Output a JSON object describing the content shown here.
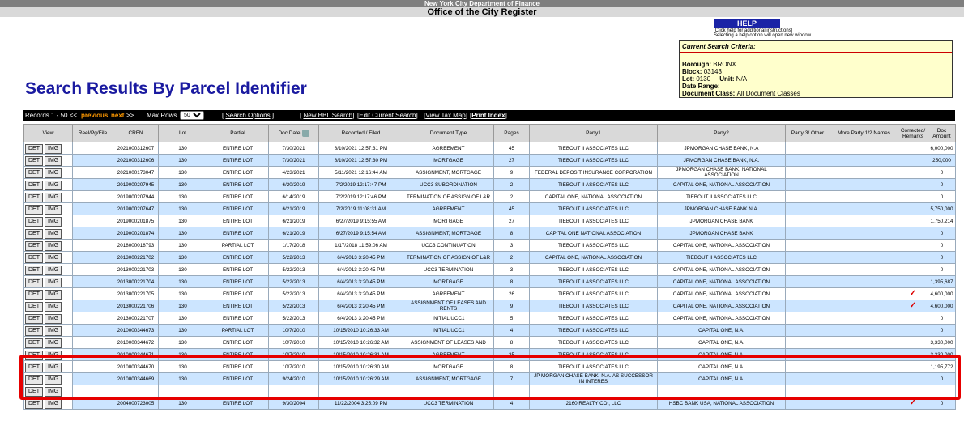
{
  "header": {
    "department": "New York City Department of Finance",
    "office": "Office of the City Register",
    "help_label": "HELP",
    "help_note_1": "[Click help for additional instructions]",
    "help_note_2": "Selecting a help option will open new window"
  },
  "criteria": {
    "title": "Current Search Criteria:",
    "borough_label": "Borough:",
    "borough": "BRONX",
    "block_label": "Block:",
    "block": "03143",
    "lot_label": "Lot:",
    "lot": "0130",
    "unit_label": "Unit:",
    "unit": "N/A",
    "date_label": "Date Range:",
    "class_label": "Document Class:",
    "class": "All Document Classes"
  },
  "page_title": "Search Results By Parcel Identifier",
  "toolbar": {
    "records": "Records 1 - 50 <<",
    "previous": "previous",
    "next": "next",
    "next_arrows": ">>",
    "max_rows_label": "Max Rows",
    "max_rows_value": "50",
    "search_options": "Search Options",
    "new_bbl": "New BBL Search",
    "edit_current": "Edit Current Search",
    "view_tax_map": "View Tax Map",
    "print_index": "Print Index"
  },
  "columns": [
    "View",
    "Reel/Pg/File",
    "CRFN",
    "Lot",
    "Partial",
    "Doc Date",
    "Recorded / Filed",
    "Document Type",
    "Pages",
    "Party1",
    "Party2",
    "Party 3/ Other",
    "More Party 1/2 Names",
    "Corrected/ Remarks",
    "Doc Amount"
  ],
  "buttons": {
    "det": "DET",
    "img": "IMG"
  },
  "rows": [
    {
      "crfn": "2021000312607",
      "lot": "130",
      "partial": "ENTIRE LOT",
      "doc_date": "7/30/2021",
      "recorded": "8/10/2021 12:57:31 PM",
      "type": "AGREEMENT",
      "pages": "45",
      "party1": "TIEBOUT II ASSOCIATES LLC",
      "party2": "JPMORGAN CHASE BANK, N.A",
      "amount": "6,000,000",
      "check": ""
    },
    {
      "crfn": "2021000312606",
      "lot": "130",
      "partial": "ENTIRE LOT",
      "doc_date": "7/30/2021",
      "recorded": "8/10/2021 12:57:30 PM",
      "type": "MORTGAGE",
      "pages": "27",
      "party1": "TIEBOUT II ASSOCIATES LLC",
      "party2": "JPMORGAN CHASE BANK, N.A.",
      "amount": "250,000",
      "check": ""
    },
    {
      "crfn": "2021000173047",
      "lot": "130",
      "partial": "ENTIRE LOT",
      "doc_date": "4/23/2021",
      "recorded": "5/11/2021 12:16:44 AM",
      "type": "ASSIGNMENT, MORTGAGE",
      "pages": "9",
      "party1": "FEDERAL DEPOSIT INSURANCE CORPORATION",
      "party2": "JPMORGAN CHASE BANK, NATIONAL ASSOCIATION",
      "amount": "0",
      "check": ""
    },
    {
      "crfn": "2019000207945",
      "lot": "130",
      "partial": "ENTIRE LOT",
      "doc_date": "6/20/2019",
      "recorded": "7/2/2019 12:17:47 PM",
      "type": "UCC3 SUBORDINATION",
      "pages": "2",
      "party1": "TIEBOUT II ASSOCIATES LLC",
      "party2": "CAPITAL ONE, NATIONAL ASSOCIATION",
      "amount": "0",
      "check": ""
    },
    {
      "crfn": "2019000207944",
      "lot": "130",
      "partial": "ENTIRE LOT",
      "doc_date": "6/14/2019",
      "recorded": "7/2/2019 12:17:46 PM",
      "type": "TERMINATION OF ASSIGN OF L&R",
      "pages": "2",
      "party1": "CAPITAL ONE, NATIONAL ASSOCIATION",
      "party2": "TIEBOUT II ASSOCIATES LLC",
      "amount": "0",
      "check": ""
    },
    {
      "crfn": "2019000207647",
      "lot": "130",
      "partial": "ENTIRE LOT",
      "doc_date": "6/21/2019",
      "recorded": "7/2/2019 11:08:31 AM",
      "type": "AGREEMENT",
      "pages": "45",
      "party1": "TIEBOUT II ASSOCIATES LLC",
      "party2": "JPMORGAN CHASE BANK N.A.",
      "amount": "5,750,000",
      "check": ""
    },
    {
      "crfn": "2019000201875",
      "lot": "130",
      "partial": "ENTIRE LOT",
      "doc_date": "6/21/2019",
      "recorded": "6/27/2019 9:15:55 AM",
      "type": "MORTGAGE",
      "pages": "27",
      "party1": "TIEBOUT II ASSOCIATES LLC",
      "party2": "JPMORGAN CHASE BANK",
      "amount": "1,750,214",
      "check": ""
    },
    {
      "crfn": "2019000201874",
      "lot": "130",
      "partial": "ENTIRE LOT",
      "doc_date": "6/21/2019",
      "recorded": "6/27/2019 9:15:54 AM",
      "type": "ASSIGNMENT, MORTGAGE",
      "pages": "8",
      "party1": "CAPITAL ONE NATIONAL ASSOCIATION",
      "party2": "JPMORGAN CHASE BANK",
      "amount": "0",
      "check": ""
    },
    {
      "crfn": "2018000018793",
      "lot": "130",
      "partial": "PARTIAL LOT",
      "doc_date": "1/17/2018",
      "recorded": "1/17/2018 11:59:06 AM",
      "type": "UCC3 CONTINUATION",
      "pages": "3",
      "party1": "TIEBOUT II ASSOCIATES LLC",
      "party2": "CAPITAL ONE, NATIONAL ASSOCIATION",
      "amount": "0",
      "check": ""
    },
    {
      "crfn": "2013000221702",
      "lot": "130",
      "partial": "ENTIRE LOT",
      "doc_date": "5/22/2013",
      "recorded": "6/4/2013 3:20:45 PM",
      "type": "TERMINATION OF ASSIGN OF L&R",
      "pages": "2",
      "party1": "CAPITAL ONE, NATIONAL ASSOCIATION",
      "party2": "TIEBOUT II ASSOCIATES LLC",
      "amount": "0",
      "check": ""
    },
    {
      "crfn": "2013000221703",
      "lot": "130",
      "partial": "ENTIRE LOT",
      "doc_date": "5/22/2013",
      "recorded": "6/4/2013 3:20:45 PM",
      "type": "UCC3 TERMINATION",
      "pages": "3",
      "party1": "TIEBOUT II ASSOCIATES LLC",
      "party2": "CAPITAL ONE, NATIONAL ASSOCIATION",
      "amount": "0",
      "check": ""
    },
    {
      "crfn": "2013000221704",
      "lot": "130",
      "partial": "ENTIRE LOT",
      "doc_date": "5/22/2013",
      "recorded": "6/4/2013 3:20:45 PM",
      "type": "MORTGAGE",
      "pages": "8",
      "party1": "TIEBOUT II ASSOCIATES LLC",
      "party2": "CAPITAL ONE, NATIONAL ASSOCIATION",
      "amount": "1,395,687",
      "check": ""
    },
    {
      "crfn": "2013000221705",
      "lot": "130",
      "partial": "ENTIRE LOT",
      "doc_date": "5/22/2013",
      "recorded": "6/4/2013 3:20:45 PM",
      "type": "AGREEMENT",
      "pages": "26",
      "party1": "TIEBOUT II ASSOCIATES LLC",
      "party2": "CAPITAL ONE, NATIONAL ASSOCIATION",
      "amount": "4,600,000",
      "check": "✓"
    },
    {
      "crfn": "2013000221706",
      "lot": "130",
      "partial": "ENTIRE LOT",
      "doc_date": "5/22/2013",
      "recorded": "6/4/2013 3:20:45 PM",
      "type": "ASSIGNMENT OF LEASES AND RENTS",
      "pages": "9",
      "party1": "TIEBOUT II ASSOCIATES LLC",
      "party2": "CAPITAL ONE, NATIONAL ASSOCIATION",
      "amount": "4,600,000",
      "check": "✓"
    },
    {
      "crfn": "2013000221707",
      "lot": "130",
      "partial": "ENTIRE LOT",
      "doc_date": "5/22/2013",
      "recorded": "6/4/2013 3:20:45 PM",
      "type": "INITIAL UCC1",
      "pages": "5",
      "party1": "TIEBOUT II ASSOCIATES LLC",
      "party2": "CAPITAL ONE, NATIONAL ASSOCIATION",
      "amount": "0",
      "check": ""
    },
    {
      "crfn": "2010000344673",
      "lot": "130",
      "partial": "PARTIAL LOT",
      "doc_date": "10/7/2010",
      "recorded": "10/15/2010 10:26:33 AM",
      "type": "INITIAL UCC1",
      "pages": "4",
      "party1": "TIEBOUT II ASSOCIATES LLC",
      "party2": "CAPITAL ONE, N.A.",
      "amount": "0",
      "check": ""
    },
    {
      "crfn": "2010000344672",
      "lot": "130",
      "partial": "ENTIRE LOT",
      "doc_date": "10/7/2010",
      "recorded": "10/15/2010 10:26:32 AM",
      "type": "ASSIGNMENT OF LEASES AND",
      "pages": "8",
      "party1": "TIEBOUT II ASSOCIATES LLC",
      "party2": "CAPITAL ONE, N.A.",
      "amount": "3,330,000",
      "check": ""
    },
    {
      "crfn": "2010000344671",
      "lot": "130",
      "partial": "ENTIRE LOT",
      "doc_date": "10/7/2010",
      "recorded": "10/15/2010 10:26:31 AM",
      "type": "AGREEMENT",
      "pages": "25",
      "party1": "TIEBOUT II ASSOCIATES LLC",
      "party2": "CAPITAL ONE, N.A.",
      "amount": "3,330,000",
      "check": ""
    },
    {
      "crfn": "2010000344670",
      "lot": "130",
      "partial": "ENTIRE LOT",
      "doc_date": "10/7/2010",
      "recorded": "10/15/2010 10:26:30 AM",
      "type": "MORTGAGE",
      "pages": "8",
      "party1": "TIEBOUT II ASSOCIATES LLC",
      "party2": "CAPITAL ONE, N.A.",
      "amount": "1,195,772",
      "check": ""
    },
    {
      "crfn": "2010000344669",
      "lot": "130",
      "partial": "ENTIRE LOT",
      "doc_date": "9/24/2010",
      "recorded": "10/15/2010 10:26:29 AM",
      "type": "ASSIGNMENT, MORTGAGE",
      "pages": "7",
      "party1": "JP MORGAN CHASE BANK, N.A. AS SUCCESSOR IN INTERES",
      "party2": "CAPITAL ONE, N.A.",
      "amount": "0",
      "check": ""
    },
    {
      "crfn": "",
      "lot": "",
      "partial": "",
      "doc_date": "",
      "recorded": "",
      "type": "",
      "pages": "",
      "party1": "",
      "party2": "",
      "amount": "",
      "check": ""
    },
    {
      "crfn": "2004000723005",
      "lot": "130",
      "partial": "ENTIRE LOT",
      "doc_date": "9/30/2004",
      "recorded": "11/22/2004 3:25:09 PM",
      "type": "UCC3 TERMINATION",
      "pages": "4",
      "party1": "2160 REALTY CO., LLC",
      "party2": "HSBC BANK USA, NATIONAL ASSOCIATION",
      "amount": "0",
      "check": "✓"
    }
  ]
}
